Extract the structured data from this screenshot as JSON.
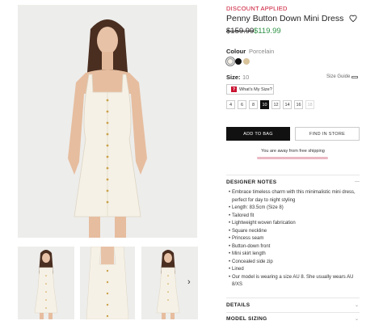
{
  "product": {
    "discount_label": "DISCOUNT APPLIED",
    "title": "Penny Button Down Mini Dress",
    "price_original": "$159.99",
    "price_sale": "$119.99"
  },
  "colour": {
    "label": "Colour",
    "selected": "Porcelain",
    "swatches": [
      "#f7f3ea",
      "#111111",
      "#d8c39b"
    ]
  },
  "size": {
    "label": "Size:",
    "selected": "10",
    "guide_label": "Size Guide",
    "fit_button": "What's My Size?",
    "fit_icon": "?",
    "options": [
      {
        "label": "4",
        "state": "available"
      },
      {
        "label": "6",
        "state": "available"
      },
      {
        "label": "8",
        "state": "available"
      },
      {
        "label": "10",
        "state": "selected"
      },
      {
        "label": "12",
        "state": "available"
      },
      {
        "label": "14",
        "state": "available"
      },
      {
        "label": "16",
        "state": "available"
      },
      {
        "label": "18",
        "state": "disabled"
      }
    ]
  },
  "actions": {
    "add_to_bag": "ADD TO BAG",
    "find_in_store": "FIND IN STORE"
  },
  "shipping": {
    "text": "You are away from free shipping",
    "progress": 1.0
  },
  "sections": {
    "designer_notes": "DESIGNER NOTES",
    "details": "DETAILS",
    "model_sizing": "MODEL SIZING"
  },
  "designer_notes": [
    "Embrace timeless charm with this minimalistic mini dress, perfect for day to night styling",
    "Length: 83.5cm (Size 8)",
    "Tailored fit",
    "Lightweight woven fabrication",
    "Square neckline",
    "Princess seam",
    "Button-down front",
    "Mini skirt length",
    "Concealed side zip",
    "Lined",
    "Our model is wearing a size AU 8. She usually wears AU 8/XS"
  ],
  "icons": {
    "wishlist": "heart-outline-icon",
    "gallery_next": "chevron-right-icon",
    "accordion": "chevron-icon"
  }
}
